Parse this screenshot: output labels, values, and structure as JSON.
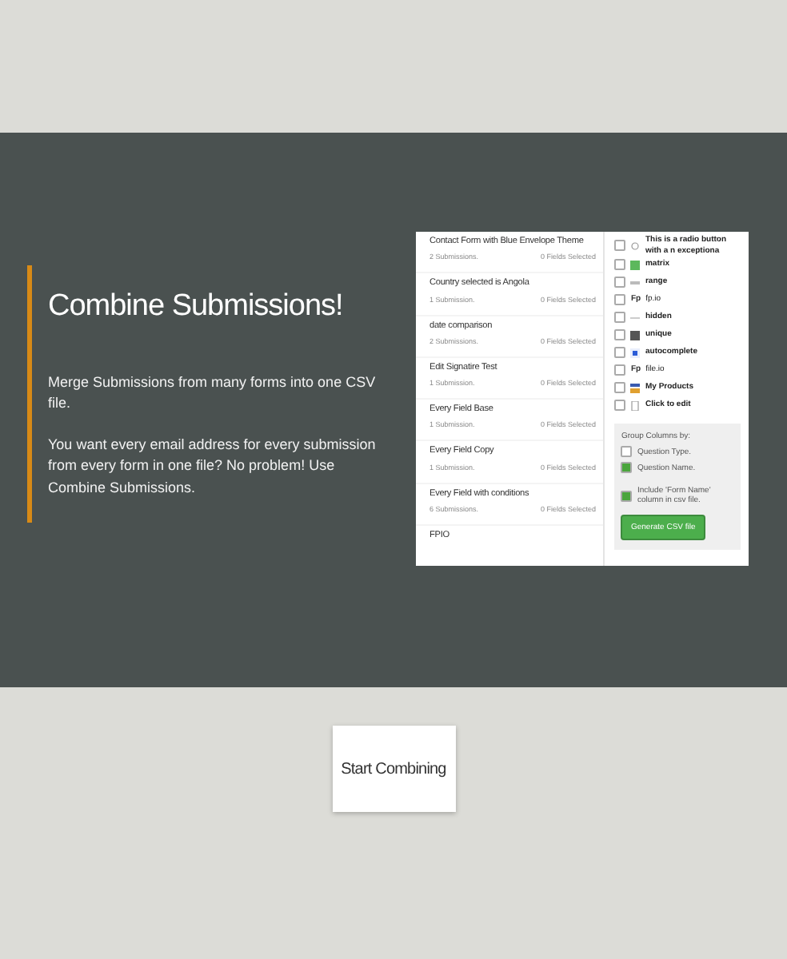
{
  "hero": {
    "title": "Combine Submissions!",
    "paragraphs": [
      "Merge Submissions from many forms into one CSV file.",
      "You want every email address for every submission from every form in one file? No problem! Use Combine Submissions."
    ]
  },
  "preview": {
    "forms": [
      {
        "name": "Contact Form with Blue Envelope Theme",
        "count": "2 Submissions.",
        "selected": "0 Fields Selected"
      },
      {
        "name": "Country selected is Angola",
        "count": "1 Submission.",
        "selected": "0 Fields Selected"
      },
      {
        "name": "date comparison",
        "count": "2 Submissions.",
        "selected": "0 Fields Selected"
      },
      {
        "name": "Edit Signatire Test",
        "count": "1 Submission.",
        "selected": "0 Fields Selected"
      },
      {
        "name": "Every Field Base",
        "count": "1 Submission.",
        "selected": "0 Fields Selected"
      },
      {
        "name": "Every Field Copy",
        "count": "1 Submission.",
        "selected": "0 Fields Selected"
      },
      {
        "name": "Every Field with conditions",
        "count": "6 Submissions.",
        "selected": "0 Fields Selected"
      },
      {
        "name": "FPIO"
      }
    ],
    "fields": [
      {
        "kind": "radio",
        "label": "This is a radio button with a n exceptiona",
        "checked": false,
        "bold": true
      },
      {
        "kind": "matrix",
        "label": "matrix",
        "checked": false,
        "bold": true
      },
      {
        "kind": "range",
        "label": "range",
        "checked": false,
        "bold": true
      },
      {
        "kind": "fp",
        "badge": "Fp",
        "label": "fp.io",
        "checked": false,
        "bold": false
      },
      {
        "kind": "hidden",
        "label": "hidden",
        "checked": false,
        "bold": true
      },
      {
        "kind": "unique",
        "label": "unique",
        "checked": false,
        "bold": true
      },
      {
        "kind": "autocomplete",
        "label": "autocomplete",
        "checked": false,
        "bold": true
      },
      {
        "kind": "fp",
        "badge": "Fp",
        "label": "file.io",
        "checked": false,
        "bold": false
      },
      {
        "kind": "products",
        "label": "My Products",
        "checked": false,
        "bold": true
      },
      {
        "kind": "edit",
        "label": "Click to edit",
        "checked": false,
        "bold": true
      }
    ],
    "group_label": "Group Columns by:",
    "group_options": [
      {
        "label": "Question Type.",
        "checked": false
      },
      {
        "label": "Question Name.",
        "checked": true
      }
    ],
    "include_form_name": {
      "label": "Include 'Form Name' column in csv file.",
      "checked": true
    },
    "generate_button": "Generate CSV file"
  },
  "start_button": "Start Combining"
}
